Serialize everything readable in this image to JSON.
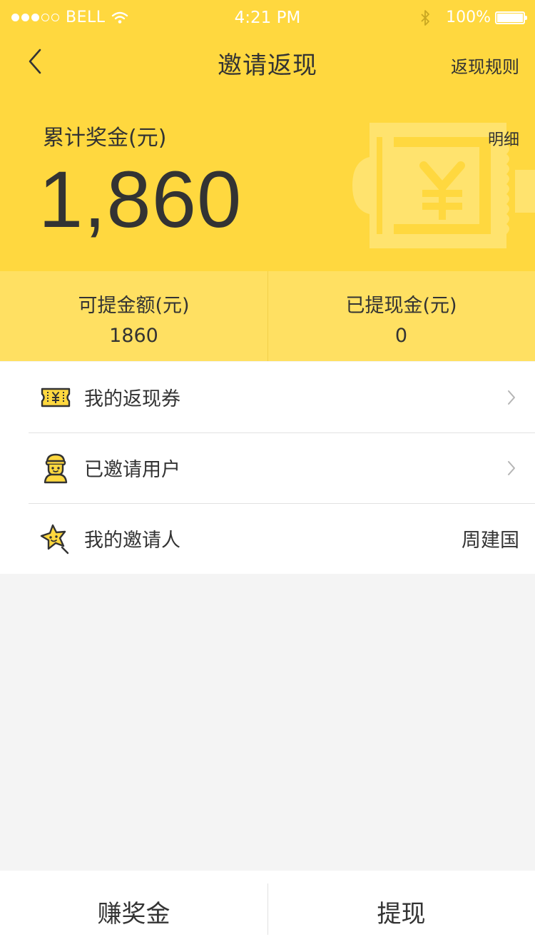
{
  "status_bar": {
    "carrier": "BELL",
    "time": "4:21 PM",
    "battery": "100%"
  },
  "nav": {
    "title": "邀请返现",
    "rules_link": "返现规则"
  },
  "summary": {
    "total_label": "累计奖金(元)",
    "total_amount": "1,860",
    "detail_link": "明细"
  },
  "stats": [
    {
      "label": "可提金额(元)",
      "value": "1860"
    },
    {
      "label": "已提现金(元)",
      "value": "0"
    }
  ],
  "menu": [
    {
      "label": "我的返现券",
      "icon": "coupon-icon"
    },
    {
      "label": "已邀请用户",
      "icon": "user-icon"
    },
    {
      "label": "我的邀请人",
      "icon": "star-icon",
      "value": "周建国"
    }
  ],
  "bottom_bar": {
    "earn_label": "赚奖金",
    "withdraw_label": "提现"
  },
  "colors": {
    "header": "#ffd83f",
    "stats_bg": "#ffe062",
    "icon_yellow": "#ffd83f"
  }
}
